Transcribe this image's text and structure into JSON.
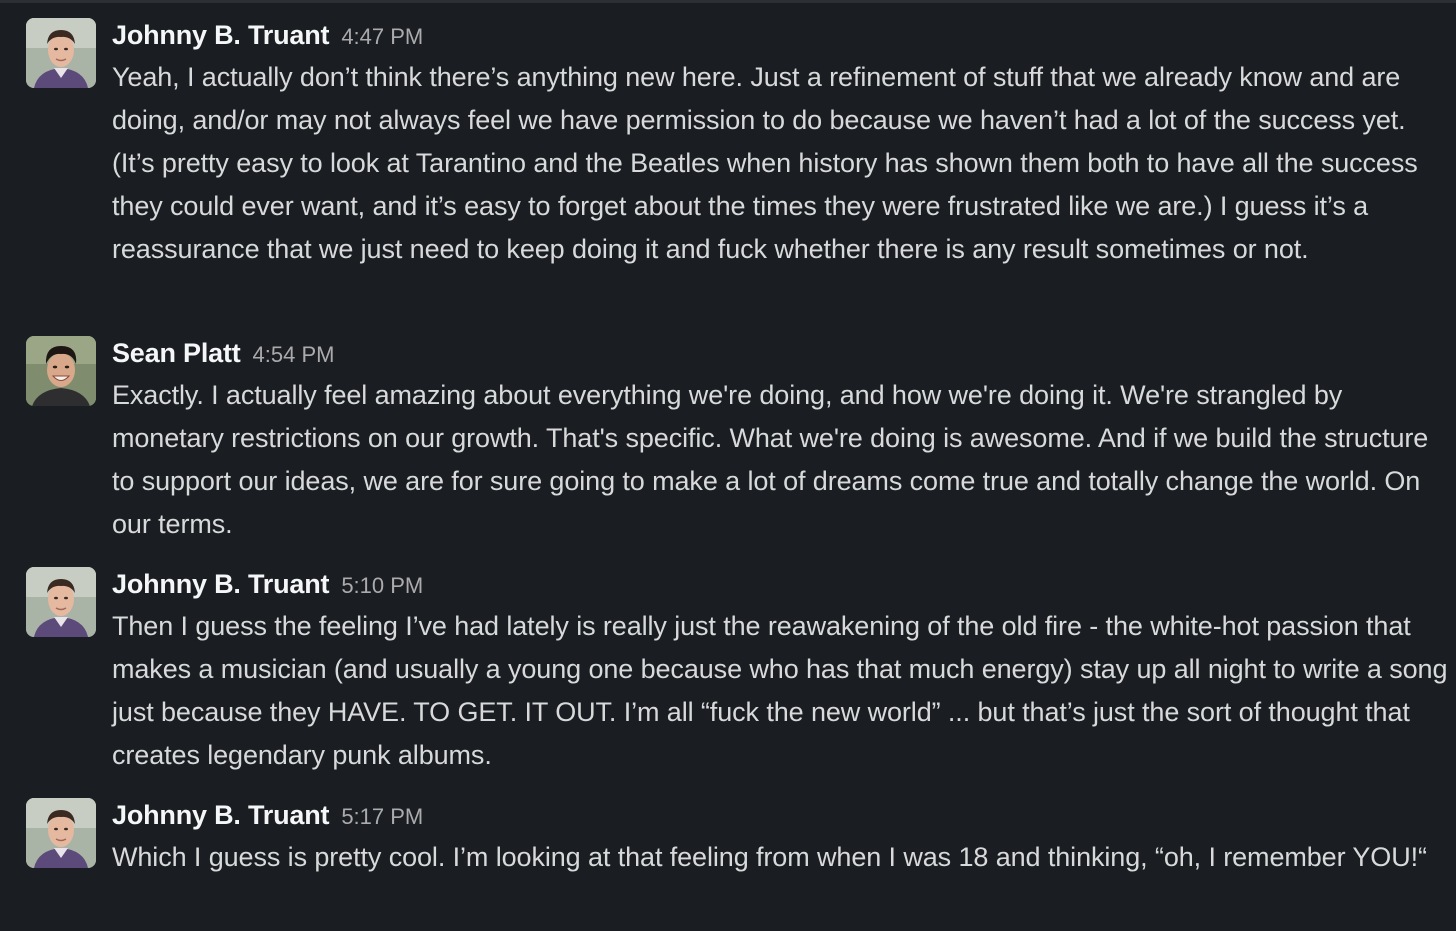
{
  "messages": [
    {
      "author": "Johnny B. Truant",
      "time": "4:47 PM",
      "avatar": "johnny-avatar",
      "text": "Yeah, I actually don’t think there’s anything new here. Just a refinement of stuff that we already know and are doing, and/or may not always feel we have permission to do because we haven’t had a lot of the success yet. (It’s pretty easy to look at Tarantino and the Beatles when history has shown them both to have all the success they could ever want, and it’s easy to forget about the times they were frustrated like we are.) I guess it’s a reassurance that we just need to keep doing it and fuck whether there is any result sometimes or not."
    },
    {
      "author": "Sean Platt",
      "time": "4:54 PM",
      "avatar": "sean-avatar",
      "text": "Exactly. I actually feel amazing about everything we're doing, and how we're doing it. We're strangled by monetary restrictions on our growth. That's specific. What we're doing is awesome. And if we build the structure to support our ideas, we are for sure going to make a lot of dreams come true and totally change the world. On our terms."
    },
    {
      "author": "Johnny B. Truant",
      "time": "5:10 PM",
      "avatar": "johnny-avatar",
      "text": "Then I guess the feeling I’ve had lately is really just the reawakening of the old fire - the white-hot passion that makes a musician (and usually a young one because who has that much energy) stay up all night to write a song just because they HAVE. TO GET. IT OUT. I’m all “fuck the new world” ... but that’s just the sort of thought that creates legendary punk albums."
    },
    {
      "author": "Johnny B. Truant",
      "time": "5:17 PM",
      "avatar": "johnny-avatar",
      "text": "Which I guess is pretty cool. I’m looking at that feeling from when I was 18 and thinking, “oh, I remember YOU!“"
    }
  ],
  "colors": {
    "background": "#1a1d21",
    "author": "#f5f6f7",
    "timestamp": "#ababad",
    "text": "#d8d9da"
  }
}
